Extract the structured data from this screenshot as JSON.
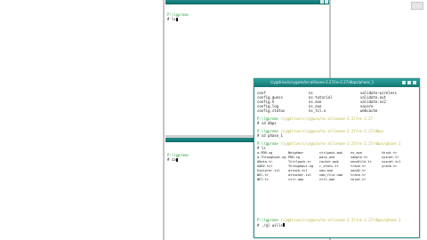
{
  "top_pane": {
    "prompt": "P:\\lgprom>",
    "command": "# ls"
  },
  "bottom_pane": {
    "prompt": "P:\\lgprom>",
    "command": "# ca"
  },
  "floating_terminal": {
    "title": "/cygdrive/c/cygwin/ns-allinone-2.27/ns-2.27/dbps/phase_1",
    "top_listing": [
      [
        "conf",
        "ns",
        "validate-wireless"
      ],
      [
        "config.guess",
        "ns-tutorial",
        "validate.out"
      ],
      [
        "config.h",
        "ns.exe",
        "validate.ns2"
      ],
      [
        "config.log",
        "ns_exe",
        "vacore"
      ],
      [
        "config.status",
        "ns_tcl.o",
        "webcache"
      ]
    ],
    "prompt1_user": "P:\\lgprom>",
    "prompt1_path": "/cygdrive/c/cygwin/ns-allinone-2.27/ns-2.27",
    "cmd1": "# cd dbps",
    "prompt2_user": "P:\\lgprom>",
    "prompt2_path": "/cygdrive/c/cygwin/ns-allinone-2.27/ns-2.27/dbps",
    "cmd2": "# cd phase_1",
    "prompt3_user": "P:\\lgprom>",
    "prompt3_path": "/cygdrive/c/cygwin/ns-allinone-2.27/ns-2.27/dbps/phase_1",
    "cmd3": "# ls",
    "ls_rows": [
      [
        "a-PDR.xg",
        "Neighbor",
        "ctrlpack.awk",
        "ns_ave",
        "thrpt.tr"
      ],
      [
        "a-Throughput.xg",
        "PDR.xg",
        "pack_ave",
        "sample.tr",
        "sysnet.tr"
      ],
      [
        "AData.tr",
        "Tctrlpack.tr",
        "router.awk",
        "sendfile.tr",
        "sysnet.tcl"
      ],
      [
        "AODV.tcl",
        "Throughput.xg",
        "r_stats.tr",
        "trace.tr",
        "yrank.tr"
      ],
      [
        "Explorer.tcl",
        "attack.tcl",
        "new.ave",
        "send2.tr",
        ""
      ],
      [
        "NEC.tr",
        "attacker.tcl",
        "nam_file.nam",
        "trace.tr",
        ""
      ],
      [
        "NET.tr",
        "ctrl.awk",
        "ctrl.awk",
        "thrpt.tr",
        ""
      ]
    ],
    "prompt4_user": "P:\\lgprom>",
    "prompt4_path": "/cygdrive/c/cygwin/ns-allinone-2.27/ns-2.27/dbps/phase_1",
    "cmd4": "# ./ql wills"
  }
}
